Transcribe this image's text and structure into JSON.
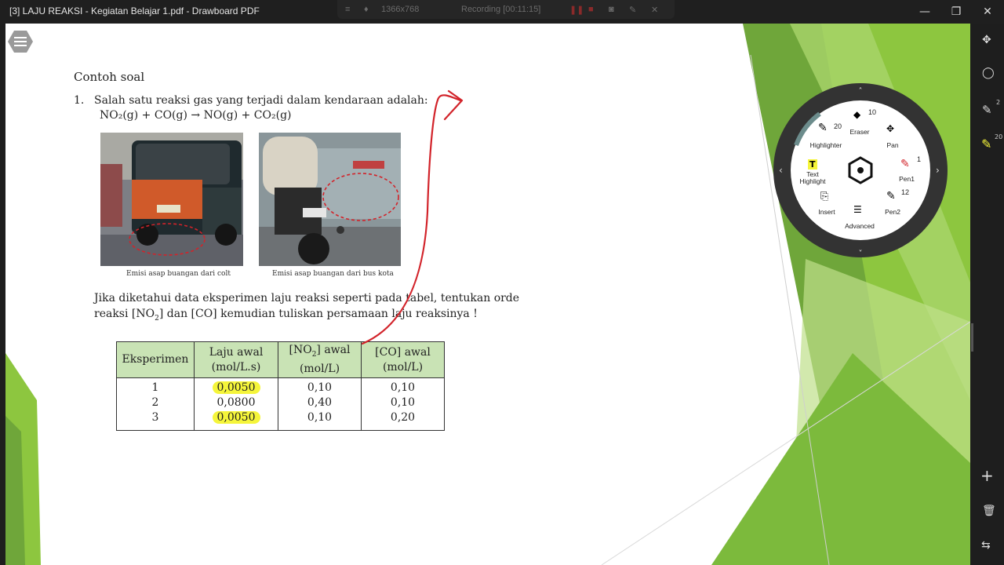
{
  "window": {
    "title": "[3] LAJU REAKSI - Kegiatan Belajar 1.pdf - Drawboard PDF",
    "minimize": "—",
    "maximize": "❐",
    "close": "✕"
  },
  "recording": {
    "resolution": "1366x768",
    "status": "Recording [00:11:15]"
  },
  "document": {
    "heading": "Contoh soal",
    "q_number": "1.",
    "q_text": "Salah satu reaksi gas yang terjadi dalam kendaraan adalah:",
    "equation": "NO₂(g) + CO(g) → NO(g) + CO₂(g)",
    "caption_left": "Emisi asap buangan dari colt",
    "caption_right": "Emisi asap buangan dari bus kota",
    "instruction_line1": "Jika diketahui data eksperimen laju reaksi seperti pada tabel, tentukan orde",
    "instruction_line2_a": "reaksi [NO",
    "instruction_line2_sub": "2",
    "instruction_line2_b": "]  dan [CO] kemudian tuliskan persamaan laju reaksinya !",
    "table": {
      "headers": {
        "h1": "Eksperimen",
        "h2_a": "Laju awal",
        "h2_b": "(mol/L.s)",
        "h3_a": "[NO",
        "h3_sub": "2",
        "h3_b": "] awal",
        "h3_c": "(mol/L)",
        "h4_a": "[CO] awal",
        "h4_b": "(mol/L)"
      },
      "rows": [
        {
          "exp": "1",
          "rate": "0,0050",
          "no2": "0,10",
          "co": "0,10"
        },
        {
          "exp": "2",
          "rate": "0,0800",
          "no2": "0,40",
          "co": "0,10"
        },
        {
          "exp": "3",
          "rate": "0,0050",
          "no2": "0,10",
          "co": "0,20"
        }
      ]
    }
  },
  "radial_menu": {
    "highlighter": {
      "label": "Highlighter",
      "size": "20"
    },
    "eraser": {
      "label": "Eraser",
      "size": "10"
    },
    "pan": {
      "label": "Pan"
    },
    "text_highlight": {
      "label_a": "Text",
      "label_b": "Highlight"
    },
    "pen1": {
      "label": "Pen1",
      "size": "1"
    },
    "insert": {
      "label": "Insert"
    },
    "advanced": {
      "label": "Advanced"
    },
    "pen2": {
      "label": "Pen2",
      "size": "12"
    }
  },
  "toolbar": {
    "pen_size": "2",
    "highlighter_size": "20"
  },
  "colors": {
    "accent_green": "#8dc63f",
    "table_header": "#c9e3b5",
    "highlight": "#f5f53a",
    "ink_red": "#d2232a"
  }
}
